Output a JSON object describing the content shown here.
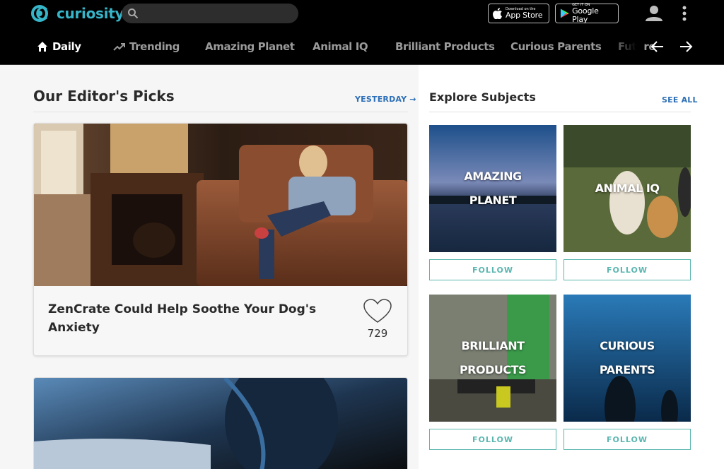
{
  "brand": {
    "name": "curiosity",
    "accent": "#37b5c8"
  },
  "search": {
    "placeholder": ""
  },
  "stores": {
    "appstore": {
      "small": "Download on the",
      "big": "App Store"
    },
    "gplay": {
      "small": "GET IT ON",
      "big": "Google Play"
    }
  },
  "nav": {
    "items": [
      {
        "label": "Daily",
        "icon": "home-icon"
      },
      {
        "label": "Trending",
        "icon": "trending-icon"
      },
      {
        "label": "Amazing Planet"
      },
      {
        "label": "Animal IQ"
      },
      {
        "label": "Brilliant Products"
      },
      {
        "label": "Curious Parents"
      },
      {
        "label": "Future"
      }
    ]
  },
  "editors": {
    "title": "Our Editor's Picks",
    "link": "YESTERDAY →",
    "card": {
      "title": "ZenCrate Could Help Soothe Your Dog's Anxiety",
      "likes": "729"
    }
  },
  "explore": {
    "title": "Explore Subjects",
    "link": "SEE ALL",
    "follow_label": "FOLLOW",
    "subjects": [
      {
        "label": "AMAZING PLANET"
      },
      {
        "label": "ANIMAL IQ"
      },
      {
        "label": "BRILLIANT PRODUCTS"
      },
      {
        "label": "CURIOUS PARENTS"
      }
    ]
  }
}
